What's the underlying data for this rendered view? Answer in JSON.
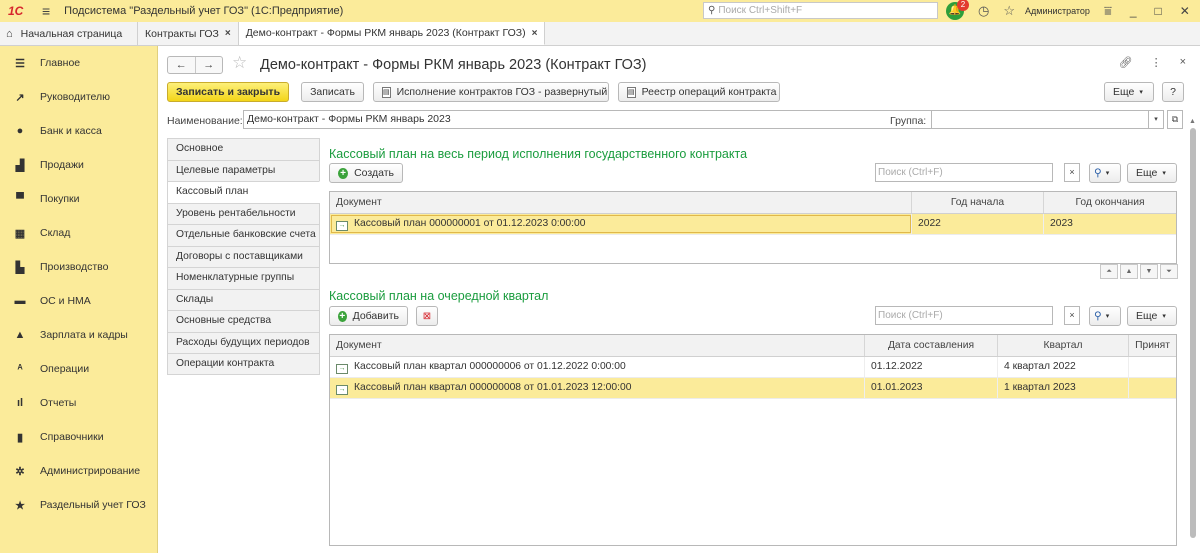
{
  "titlebar": {
    "logo": "1С",
    "app_title": "Подсистема \"Раздельный учет ГОЗ\"  (1С:Предприятие)",
    "search_placeholder": "Поиск Ctrl+Shift+F",
    "notifications_count": "2",
    "user": "Администратор"
  },
  "tabs": {
    "home": "Начальная страница",
    "tab1": "Контракты ГОЗ",
    "tab2": "Демо-контракт - Формы РКМ январь 2023 (Контракт ГОЗ)"
  },
  "sidebar": {
    "items": [
      {
        "label": "Главное",
        "icon": "☰"
      },
      {
        "label": "Руководителю",
        "icon": "↗"
      },
      {
        "label": "Банк и касса",
        "icon": "●"
      },
      {
        "label": "Продажи",
        "icon": "▟"
      },
      {
        "label": "Покупки",
        "icon": "▀"
      },
      {
        "label": "Склад",
        "icon": "▦"
      },
      {
        "label": "Производство",
        "icon": "▙"
      },
      {
        "label": "ОС и НМА",
        "icon": "▬"
      },
      {
        "label": "Зарплата и кадры",
        "icon": "▲"
      },
      {
        "label": "Операции",
        "icon": "ᴬ"
      },
      {
        "label": "Отчеты",
        "icon": "ıl"
      },
      {
        "label": "Справочники",
        "icon": "▮"
      },
      {
        "label": "Администрирование",
        "icon": "✲"
      },
      {
        "label": "Раздельный учет ГОЗ",
        "icon": "★"
      }
    ]
  },
  "form": {
    "title": "Демо-контракт - Формы РКМ январь 2023 (Контракт ГОЗ)",
    "save_close": "Записать и закрыть",
    "save": "Записать",
    "report1": "Исполнение контрактов ГОЗ - развернутый",
    "report2": "Реестр операций контракта",
    "more": "Еще",
    "help": "?",
    "name_label": "Наименование:",
    "name_value": "Демо-контракт - Формы РКМ январь 2023",
    "group_label": "Группа:",
    "group_value": ""
  },
  "pages": [
    "Основное",
    "Целевые параметры",
    "Кассовый план",
    "Уровень рентабельности",
    "Отдельные банковские счета",
    "Договоры с поставщиками",
    "Номенклатурные группы",
    "Склады",
    "Основные средства",
    "Расходы будущих периодов",
    "Операции контракта"
  ],
  "section1": {
    "title": "Кассовый план на весь период исполнения государственного контракта",
    "create": "Создать",
    "search_placeholder": "Поиск (Ctrl+F)",
    "search_btn": "Q",
    "more": "Еще",
    "columns": [
      "Документ",
      "Год начала",
      "Год окончания"
    ],
    "rows": [
      {
        "doc": "Кассовый план 000000001 от 01.12.2023 0:00:00",
        "start": "2022",
        "end": "2023"
      }
    ]
  },
  "section2": {
    "title": "Кассовый план на очередной квартал",
    "add": "Добавить",
    "search_placeholder": "Поиск (Ctrl+F)",
    "search_btn": "Q",
    "more": "Еще",
    "columns": [
      "Документ",
      "Дата составления",
      "Квартал",
      "Принят"
    ],
    "rows": [
      {
        "doc": "Кассовый план квартал 000000006 от 01.12.2022 0:00:00",
        "date": "01.12.2022",
        "quarter": "4 квартал 2022",
        "accepted": ""
      },
      {
        "doc": "Кассовый план квартал 000000008 от 01.01.2023 12:00:00",
        "date": "01.01.2023",
        "quarter": "1 квартал 2023",
        "accepted": ""
      }
    ]
  }
}
